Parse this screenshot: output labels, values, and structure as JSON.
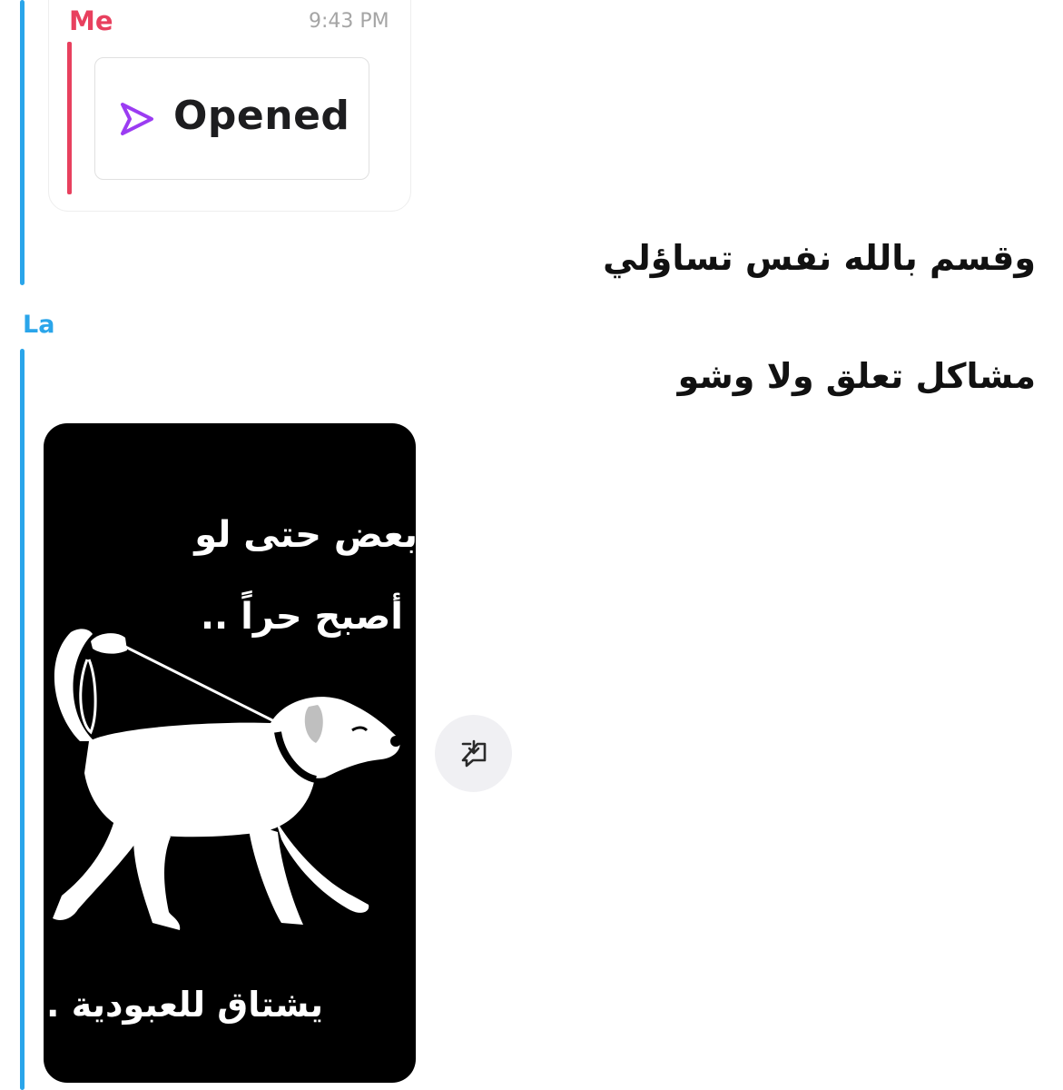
{
  "header": {
    "sender_me": "Me",
    "timestamp": "9:43 PM"
  },
  "snap_status": {
    "label": "Opened",
    "icon": "sent-arrow-icon",
    "icon_color": "#9b3cf2"
  },
  "messages": [
    {
      "text": "وقسم بالله نفس تساؤلي"
    },
    {
      "text": "مشاكل تعلق ولا وشو"
    }
  ],
  "sender_other": "La",
  "image_card": {
    "line1": "بعض حتى لو",
    "line2": "أصبح حراً ..",
    "line3": "يشتاق للعبودية ."
  },
  "save_button": {
    "icon": "save-to-chat-icon"
  },
  "colors": {
    "me_accent": "#e8405e",
    "other_accent": "#2aa5ea",
    "opened_icon": "#9b3cf2"
  }
}
